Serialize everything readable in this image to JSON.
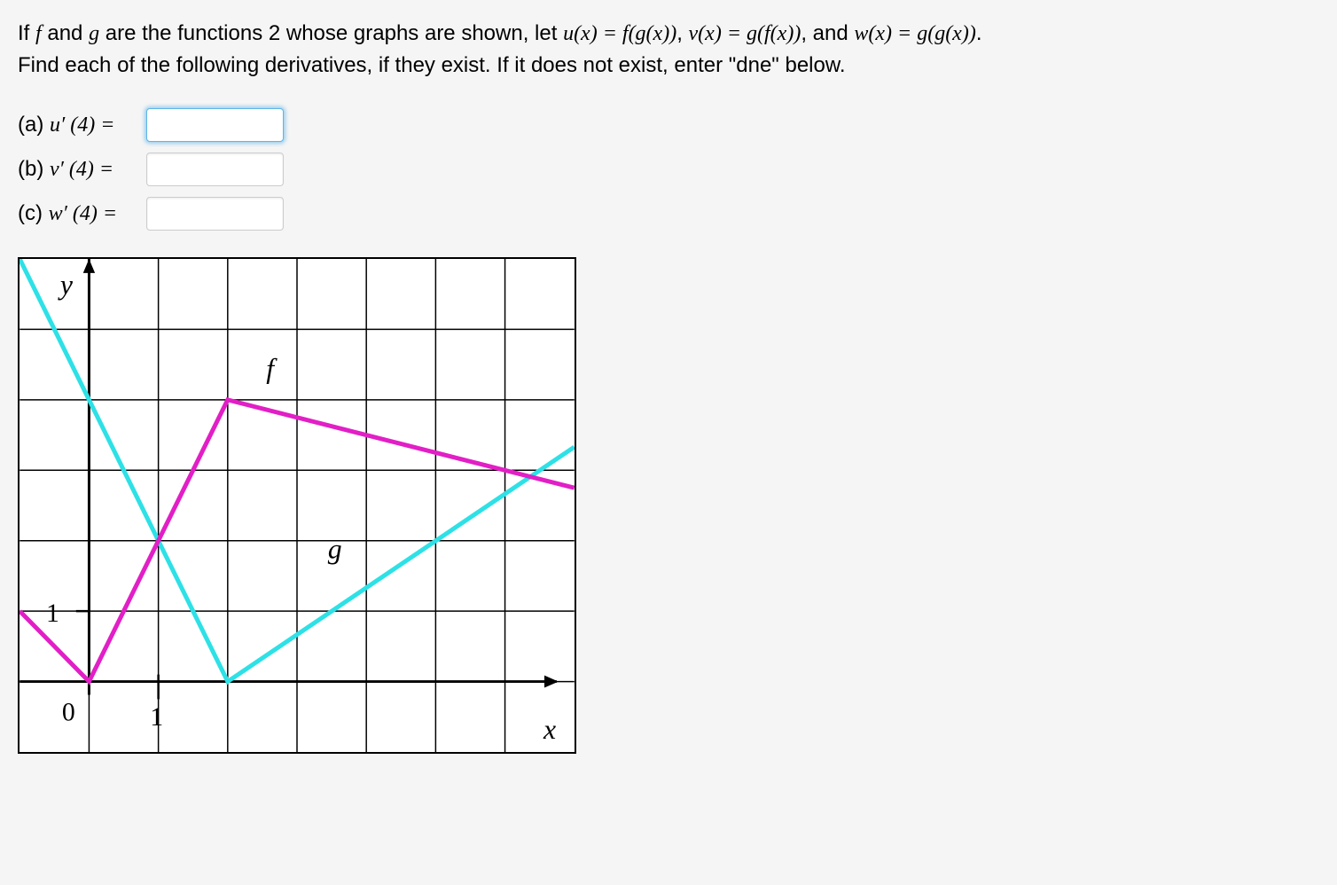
{
  "problem": {
    "line1_prefix": "If ",
    "line1_f": "f",
    "line1_mid1": " and ",
    "line1_g": "g",
    "line1_mid2": " are the functions 2 whose graphs are shown, let ",
    "u_def": "u(x) = f(g(x))",
    "comma1": ", ",
    "v_def": "v(x) = g(f(x))",
    "comma2": ", and ",
    "w_def": "w(x) = g(g(x))",
    "period": ".",
    "line2": "Find each of the following derivatives, if they exist. If it does not exist, enter \"dne\" below."
  },
  "parts": {
    "a": {
      "prefix": "(a) ",
      "expr": "u′ (4) ="
    },
    "b": {
      "prefix": "(b) ",
      "expr": "v′ (4) ="
    },
    "c": {
      "prefix": "(c) ",
      "expr": "w′ (4) ="
    }
  },
  "graph": {
    "y_label": "y",
    "x_label": "x",
    "f_label": "f",
    "g_label": "g",
    "tick_0": "0",
    "tick_1_x": "1",
    "tick_1_y": "1"
  },
  "chart_data": {
    "type": "line",
    "x_range": [
      -1,
      7
    ],
    "y_range": [
      -1,
      6
    ],
    "grid": true,
    "series": [
      {
        "name": "f",
        "color": "#e21fc6",
        "points": [
          {
            "x": -1,
            "y": 1
          },
          {
            "x": 0,
            "y": 0
          },
          {
            "x": 2,
            "y": 4
          },
          {
            "x": 7,
            "y": 2.75
          }
        ]
      },
      {
        "name": "g",
        "color": "#2de1e6",
        "points": [
          {
            "x": -1,
            "y": 6
          },
          {
            "x": 2,
            "y": 0
          },
          {
            "x": 7,
            "y": 3.33
          }
        ]
      }
    ],
    "axis_labels": {
      "x": "x",
      "y": "y"
    },
    "tick_labels": {
      "x": [
        "0",
        "1"
      ],
      "y": [
        "1"
      ]
    }
  }
}
